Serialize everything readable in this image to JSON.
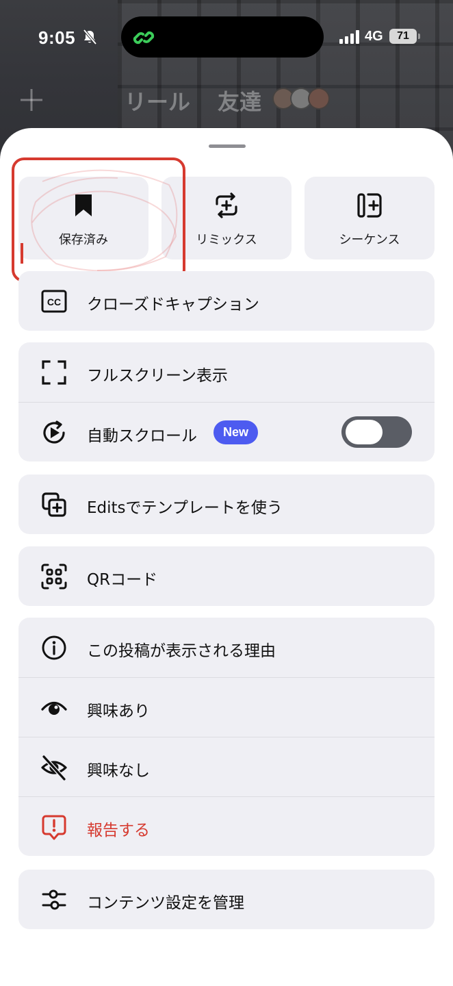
{
  "status_bar": {
    "time": "9:05",
    "network": "4G",
    "battery": "71",
    "icons": [
      "bell-slash-icon",
      "link-icon",
      "cellular-signal-icon",
      "battery-icon"
    ]
  },
  "background_nav": {
    "reels_tab": "リール",
    "friends_tab": "友達",
    "icons": [
      "plus-icon",
      "friend-avatars"
    ]
  },
  "sheet": {
    "quick_actions": [
      {
        "label": "保存済み",
        "icon": "bookmark-icon"
      },
      {
        "label": "リミックス",
        "icon": "remix-icon"
      },
      {
        "label": "シーケンス",
        "icon": "sequence-icon"
      }
    ],
    "closed_captions": {
      "label": "クローズドキャプション",
      "icon": "cc-icon"
    },
    "playback": {
      "fullscreen": {
        "label": "フルスクリーン表示",
        "icon": "fullscreen-icon"
      },
      "autoscroll": {
        "label": "自動スクロール",
        "icon": "autoscroll-icon",
        "badge": "New",
        "enabled": true
      }
    },
    "edits_template": {
      "label": "Editsでテンプレートを使う",
      "icon": "add-template-icon"
    },
    "qr_code": {
      "label": "QRコード",
      "icon": "qr-code-icon"
    },
    "feedback": {
      "why_seeing": {
        "label": "この投稿が表示される理由",
        "icon": "info-icon"
      },
      "interested": {
        "label": "興味あり",
        "icon": "eye-icon"
      },
      "not_interested": {
        "label": "興味なし",
        "icon": "eye-slash-icon"
      },
      "report": {
        "label": "報告する",
        "icon": "report-icon",
        "color": "#d63a2f"
      }
    },
    "content_settings": {
      "label": "コンテンツ設定を管理",
      "icon": "sliders-icon"
    }
  },
  "colors": {
    "accent_badge": "#4d5bf0",
    "danger": "#d63a2f",
    "highlight_box": "#d63a2f",
    "toggle_track": "#5a5d65",
    "sheet_row_bg": "#efeff4"
  }
}
